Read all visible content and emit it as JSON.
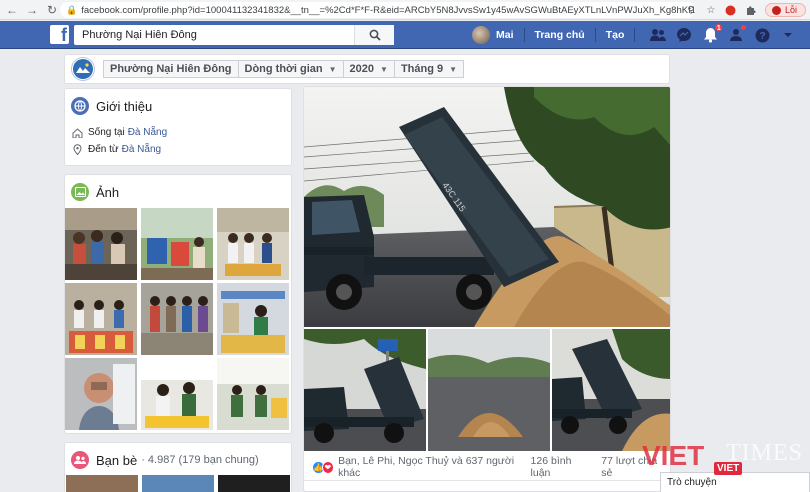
{
  "browser": {
    "url": "facebook.com/profile.php?id=100041132341832&__tn__=%2Cd*F*F-R&eid=ARCbY5N8JvvsSw1y45wAvSGWuBtAEyXTLnLVnPWJuXh_Kg8hKf1jBuKsS1G0tXJ...",
    "error_label": "Lỗi"
  },
  "fb": {
    "search_value": "Phường Nại Hiên Đông",
    "user_name": "Mai",
    "home_label": "Trang chủ",
    "create_label": "Tạo",
    "notification_count": "1"
  },
  "timeline_nav": {
    "crumbs": [
      "Phường Nại Hiên Đông",
      "Dòng thời gian",
      "2020",
      "Tháng 9"
    ]
  },
  "intro": {
    "title": "Giới thiệu",
    "lives_prefix": "Sống tại",
    "lives_city": "Đà Nẵng",
    "from_prefix": "Đến từ",
    "from_city": "Đà Nẵng"
  },
  "photos": {
    "title": "Ảnh"
  },
  "friends": {
    "title": "Bạn bè",
    "count": "· 4.987 (179 bạn chung)"
  },
  "post": {
    "reactors": "Bạn, Lê Phi, Ngọc Thuỷ và 637 người khác",
    "comments": "126 bình luận",
    "shares": "77 lượt chia sẻ"
  },
  "watermark": {
    "brand_red": "VIET",
    "brand_white": "TIMES",
    "mini": "VIET"
  },
  "chat": {
    "label": "Trò chuyện"
  },
  "colors": {
    "fb_blue": "#4267b2",
    "link": "#385898",
    "watermark_red": "#e0293d"
  }
}
